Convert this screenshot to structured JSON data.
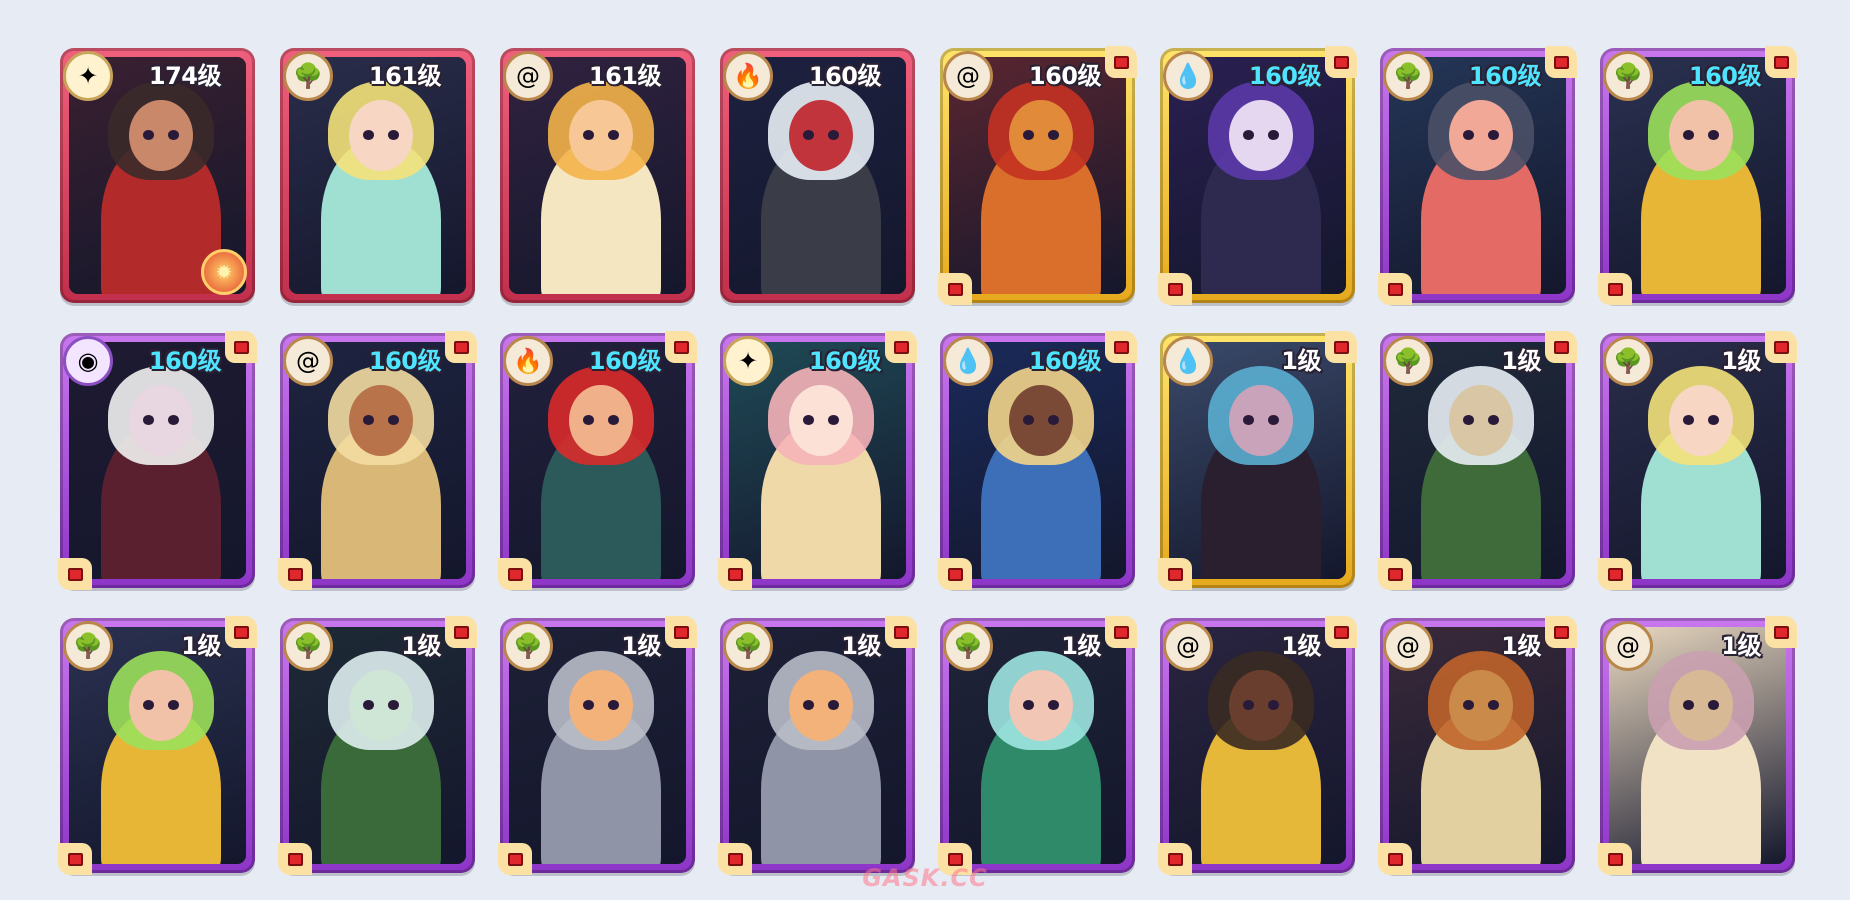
{
  "watermark": "GASK.CC",
  "element_glyphs": {
    "star-compass-icon": "✦",
    "tree-icon": "🌳",
    "shell-icon": "@",
    "fire-icon": "🔥",
    "water-drop-icon": "💧",
    "moon-eye-icon": "◉"
  },
  "colors": {
    "red_frame": "#d8405e",
    "gold_frame": "#f5c532",
    "purple_frame": "#a94fd9",
    "level_white": "#ffffff",
    "level_cyan": "#4fe4ff"
  },
  "cards": [
    {
      "level": "174级",
      "element": "star-compass-icon",
      "frame": "red",
      "level_color": "white",
      "flag": false,
      "corner": false,
      "crest": true,
      "art": {
        "bg": "#3a2030",
        "skin": "#c9886a",
        "hair": "#3b2a2a",
        "body": "#b32a2a"
      }
    },
    {
      "level": "161级",
      "element": "tree-icon",
      "frame": "red",
      "level_color": "white",
      "flag": false,
      "corner": false,
      "crest": false,
      "art": {
        "bg": "#2a2d4a",
        "skin": "#f7d6c4",
        "hair": "#f4e27a",
        "body": "#9fe0d2"
      }
    },
    {
      "level": "161级",
      "element": "shell-icon",
      "frame": "red",
      "level_color": "white",
      "flag": false,
      "corner": false,
      "crest": false,
      "art": {
        "bg": "#312240",
        "skin": "#f7c896",
        "hair": "#f4b24a",
        "body": "#f3e6c0"
      }
    },
    {
      "level": "160级",
      "element": "fire-icon",
      "frame": "red",
      "level_color": "white",
      "flag": false,
      "corner": false,
      "crest": false,
      "art": {
        "bg": "#1d2140",
        "skin": "#c2343c",
        "hair": "#e8eef5",
        "body": "#3a3c48"
      }
    },
    {
      "level": "160级",
      "element": "shell-icon",
      "frame": "gold",
      "level_color": "white",
      "flag": true,
      "corner": true,
      "crest": false,
      "art": {
        "bg": "#5a2630",
        "skin": "#e08a3a",
        "hair": "#c43222",
        "body": "#d96f2a"
      }
    },
    {
      "level": "160级",
      "element": "water-drop-icon",
      "frame": "gold",
      "level_color": "cyan",
      "flag": true,
      "corner": true,
      "crest": false,
      "art": {
        "bg": "#2a1f52",
        "skin": "#e6d7f0",
        "hair": "#5b3aa8",
        "body": "#2e2a4f"
      }
    },
    {
      "level": "160级",
      "element": "tree-icon",
      "frame": "purple",
      "level_color": "cyan",
      "flag": true,
      "corner": true,
      "crest": false,
      "art": {
        "bg": "#243657",
        "skin": "#f2a896",
        "hair": "#4a5066",
        "body": "#e46a66"
      }
    },
    {
      "level": "160级",
      "element": "tree-icon",
      "frame": "purple",
      "level_color": "cyan",
      "flag": true,
      "corner": true,
      "crest": false,
      "art": {
        "bg": "#2a3150",
        "skin": "#f2c2a8",
        "hair": "#9be05a",
        "body": "#e8b637"
      }
    },
    {
      "level": "160级",
      "element": "moon-eye-icon",
      "frame": "purple",
      "level_color": "cyan",
      "flag": true,
      "corner": true,
      "crest": false,
      "art": {
        "bg": "#1e1a32",
        "skin": "#e8d6e0",
        "hair": "#f1f1f1",
        "body": "#5a2030"
      }
    },
    {
      "level": "160级",
      "element": "shell-icon",
      "frame": "purple",
      "level_color": "cyan",
      "flag": true,
      "corner": true,
      "crest": false,
      "art": {
        "bg": "#1e2440",
        "skin": "#b8734a",
        "hair": "#f3dca0",
        "body": "#d9b877"
      }
    },
    {
      "level": "160级",
      "element": "fire-icon",
      "frame": "purple",
      "level_color": "cyan",
      "flag": true,
      "corner": true,
      "crest": false,
      "art": {
        "bg": "#22203c",
        "skin": "#f0b08a",
        "hair": "#d92a2a",
        "body": "#2c5a5a"
      }
    },
    {
      "level": "160级",
      "element": "star-compass-icon",
      "frame": "purple",
      "level_color": "cyan",
      "flag": true,
      "corner": true,
      "crest": false,
      "art": {
        "bg": "#1f4a56",
        "skin": "#fbe1d6",
        "hair": "#f6b2b8",
        "body": "#f0d9a8"
      }
    },
    {
      "level": "160级",
      "element": "water-drop-icon",
      "frame": "purple",
      "level_color": "cyan",
      "flag": true,
      "corner": true,
      "crest": false,
      "art": {
        "bg": "#1a2a5a",
        "skin": "#7a4a36",
        "hair": "#f2d48a",
        "body": "#3d6fb8"
      }
    },
    {
      "level": "1级",
      "element": "water-drop-icon",
      "frame": "gold",
      "level_color": "white",
      "flag": true,
      "corner": true,
      "crest": false,
      "art": {
        "bg": "#3a4a6a",
        "skin": "#c9a3ba",
        "hair": "#5aaed0",
        "body": "#2a1f2e"
      }
    },
    {
      "level": "1级",
      "element": "tree-icon",
      "frame": "purple",
      "level_color": "white",
      "flag": true,
      "corner": true,
      "crest": false,
      "art": {
        "bg": "#1f2a3a",
        "skin": "#d8c6a4",
        "hair": "#e8eef5",
        "body": "#3f6a3a"
      }
    },
    {
      "level": "1级",
      "element": "tree-icon",
      "frame": "purple",
      "level_color": "white",
      "flag": true,
      "corner": true,
      "crest": false,
      "art": {
        "bg": "#2a2d4a",
        "skin": "#f7d6c4",
        "hair": "#f4e27a",
        "body": "#9fe0d2"
      }
    },
    {
      "level": "1级",
      "element": "tree-icon",
      "frame": "purple",
      "level_color": "white",
      "flag": true,
      "corner": true,
      "crest": false,
      "art": {
        "bg": "#2a3150",
        "skin": "#f2c2a8",
        "hair": "#9be05a",
        "body": "#e8b637"
      }
    },
    {
      "level": "1级",
      "element": "tree-icon",
      "frame": "purple",
      "level_color": "white",
      "flag": true,
      "corner": true,
      "crest": false,
      "art": {
        "bg": "#1e2a36",
        "skin": "#cfe6d6",
        "hair": "#dfeeee",
        "body": "#3a6a3a"
      }
    },
    {
      "level": "1级",
      "element": "tree-icon",
      "frame": "purple",
      "level_color": "white",
      "flag": true,
      "corner": true,
      "crest": false,
      "art": {
        "bg": "#1d2036",
        "skin": "#f3b27a",
        "hair": "#b9bcc8",
        "body": "#8f94a6"
      }
    },
    {
      "level": "1级",
      "element": "tree-icon",
      "frame": "purple",
      "level_color": "white",
      "flag": true,
      "corner": true,
      "crest": false,
      "art": {
        "bg": "#1d2036",
        "skin": "#f3b27a",
        "hair": "#b9bcc8",
        "body": "#8f94a6"
      }
    },
    {
      "level": "1级",
      "element": "tree-icon",
      "frame": "purple",
      "level_color": "white",
      "flag": true,
      "corner": true,
      "crest": false,
      "art": {
        "bg": "#1f2438",
        "skin": "#f2c6b4",
        "hair": "#9fe6e2",
        "body": "#2f8a6a"
      }
    },
    {
      "level": "1级",
      "element": "shell-icon",
      "frame": "purple",
      "level_color": "white",
      "flag": true,
      "corner": true,
      "crest": false,
      "art": {
        "bg": "#2a2440",
        "skin": "#6a3e2e",
        "hair": "#3a2a22",
        "body": "#e6b83a"
      }
    },
    {
      "level": "1级",
      "element": "shell-icon",
      "frame": "purple",
      "level_color": "white",
      "flag": true,
      "corner": true,
      "crest": false,
      "art": {
        "bg": "#3a2a3a",
        "skin": "#c98a4a",
        "hair": "#c0642a",
        "body": "#e3d0a0"
      }
    },
    {
      "level": "1级",
      "element": "shell-icon",
      "frame": "purple",
      "level_color": "white",
      "flag": true,
      "corner": true,
      "crest": false,
      "art": {
        "bg": "#e9d8c0",
        "skin": "#d7b996",
        "hair": "#caa0b0",
        "body": "#f1e2c6"
      }
    }
  ]
}
